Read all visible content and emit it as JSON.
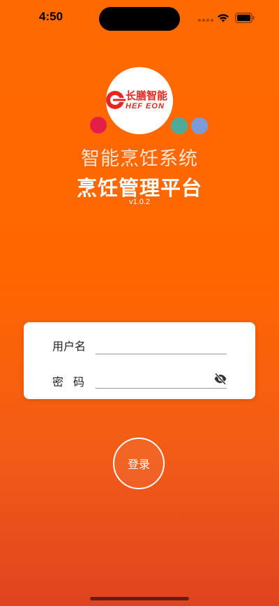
{
  "status_bar": {
    "time": "4:50",
    "icons": [
      "signal-dots-icon",
      "wifi-icon",
      "battery-icon"
    ]
  },
  "logo": {
    "brand_cn": "长膳智能",
    "brand_en": "HEF EON",
    "accent_color": "#e8261f"
  },
  "header": {
    "subtitle": "智能烹饪系统",
    "title": "烹饪管理平台",
    "version": "v1.0.2"
  },
  "form": {
    "username_label": "用户名",
    "username_value": "",
    "password_label": "密码",
    "password_value": "",
    "password_toggle_icon": "eye-off-icon"
  },
  "actions": {
    "login_label": "登录"
  },
  "colors": {
    "background_top": "#ff6a00",
    "background_bottom": "#e0431f",
    "dot_red": "#e31f49",
    "dot_teal": "#4fab99",
    "dot_blue": "#7b9cd6"
  }
}
